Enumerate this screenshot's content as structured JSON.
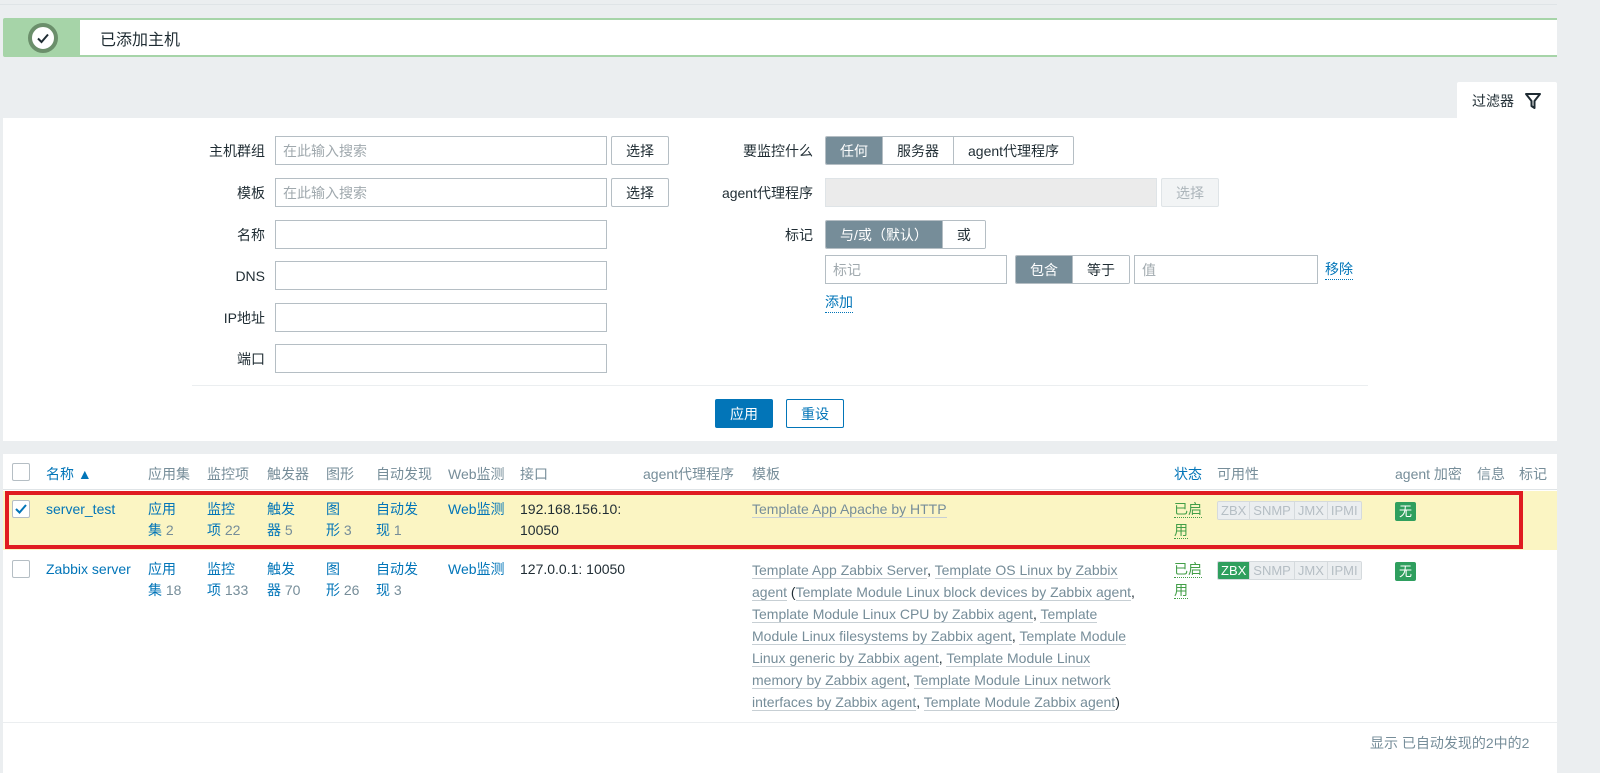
{
  "message": {
    "text": "已添加主机",
    "icon": "check-circle-icon",
    "close": "×"
  },
  "filter_tab": {
    "label": "过滤器",
    "icon": "filter-funnel-icon"
  },
  "filter": {
    "host_groups": {
      "label": "主机群组",
      "placeholder": "在此输入搜索",
      "button": "选择"
    },
    "templates": {
      "label": "模板",
      "placeholder": "在此输入搜索",
      "button": "选择"
    },
    "name": {
      "label": "名称",
      "value": ""
    },
    "dns": {
      "label": "DNS",
      "value": ""
    },
    "ip": {
      "label": "IP地址",
      "value": ""
    },
    "port": {
      "label": "端口",
      "value": ""
    },
    "monitored_by": {
      "label": "要监控什么",
      "options": [
        "任何",
        "服务器",
        "agent代理程序"
      ],
      "selected": "任何"
    },
    "proxy": {
      "label": "agent代理程序",
      "button": "选择"
    },
    "tags": {
      "label": "标记",
      "mode_options": [
        "与/或（默认）",
        "或"
      ],
      "mode_selected": "与/或（默认）",
      "tag_placeholder": "标记",
      "op_options": [
        "包含",
        "等于"
      ],
      "op_selected": "包含",
      "value_placeholder": "值",
      "remove": "移除",
      "add": "添加"
    },
    "apply": "应用",
    "reset": "重设"
  },
  "table": {
    "columns": {
      "name": "名称 ▲",
      "applications": "应用集",
      "items": "监控项",
      "triggers": "触发器",
      "graphs": "图形",
      "discovery": "自动发现",
      "web": "Web监测",
      "interface": "接口",
      "proxy": "agent代理程序",
      "templates": "模板",
      "status": "状态",
      "availability": "可用性",
      "encryption": "agent 加密",
      "info": "信息",
      "tags": "标记"
    },
    "rows": [
      {
        "selected": true,
        "name": "server_test",
        "applications": {
          "label1": "应用",
          "label2": "集",
          "count": "2"
        },
        "items": {
          "label1": "监控",
          "label2": "项",
          "count": "22"
        },
        "triggers": {
          "label1": "触发",
          "label2": "器",
          "count": "5"
        },
        "graphs": {
          "label1": "图",
          "label2": "形",
          "count": "3"
        },
        "discovery": {
          "label1": "自动发",
          "label2": "现",
          "count": "1"
        },
        "web": "Web监测",
        "interface_line1": "192.168.156.10:",
        "interface_line2": "10050",
        "templates": [
          "Template App Apache by HTTP"
        ],
        "status_line1": "已启",
        "status_line2": "用",
        "availability": [
          "ZBX",
          "SNMP",
          "JMX",
          "IPMI"
        ],
        "availability_active": [],
        "encryption": "无"
      },
      {
        "selected": false,
        "name": "Zabbix server",
        "applications": {
          "label1": "应用",
          "label2": "集",
          "count": "18"
        },
        "items": {
          "label1": "监控",
          "label2": "项",
          "count": "133"
        },
        "triggers": {
          "label1": "触发",
          "label2": "器",
          "count": "70"
        },
        "graphs": {
          "label1": "图",
          "label2": "形",
          "count": "26"
        },
        "discovery": {
          "label1": "自动发",
          "label2": "现",
          "count": "3"
        },
        "web": "Web监测",
        "interface_line1": "127.0.0.1: 10050",
        "templates_lines": [
          [
            "Template App Zabbix Server",
            ", ",
            "Template OS Linux by Zabbix"
          ],
          [
            "agent",
            " (",
            "Template Module Linux block devices by Zabbix agent",
            ","
          ],
          [
            "Template Module Linux CPU by Zabbix agent",
            ", ",
            "Template"
          ],
          [
            "Module Linux filesystems by Zabbix agent",
            ", ",
            "Template Module"
          ],
          [
            "Linux generic by Zabbix agent",
            ", ",
            "Template Module Linux"
          ],
          [
            "memory by Zabbix agent",
            ", ",
            "Template Module Linux network"
          ],
          [
            "interfaces by Zabbix agent",
            ", ",
            "Template Module Zabbix agent",
            ")"
          ]
        ],
        "status_line1": "已启",
        "status_line2": "用",
        "availability": [
          "ZBX",
          "SNMP",
          "JMX",
          "IPMI"
        ],
        "availability_active": [
          "ZBX"
        ],
        "encryption": "无"
      }
    ]
  },
  "footer": "显示 已自动发现的2中的2"
}
